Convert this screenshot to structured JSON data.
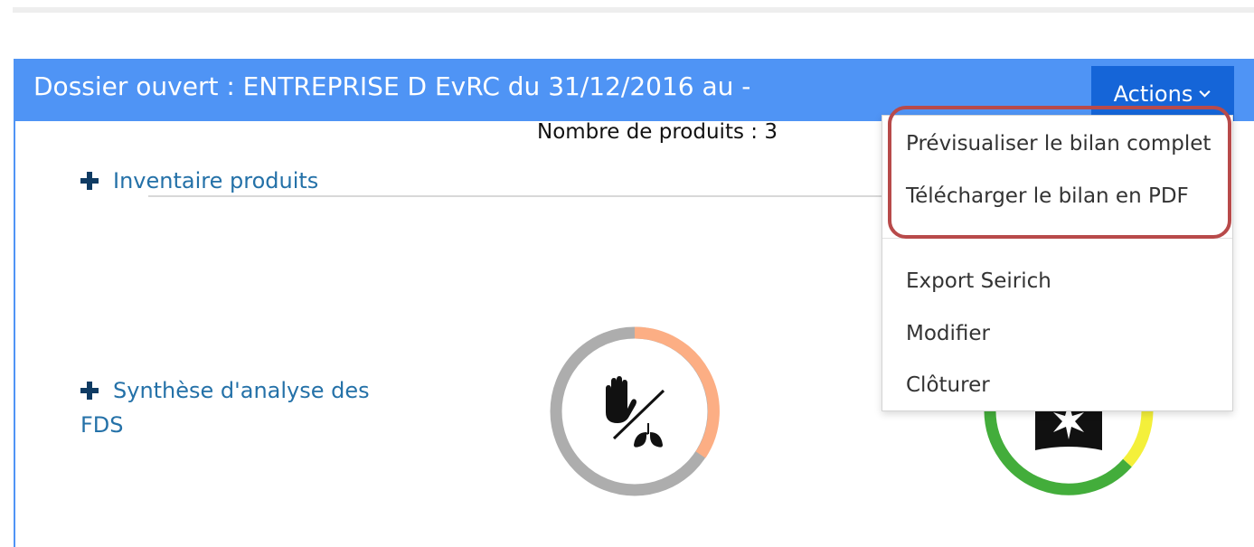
{
  "header": {
    "title": "Dossier ouvert : ENTREPRISE D EvRC du 31/12/2016 au -",
    "actions_label": "Actions"
  },
  "sections": {
    "inventory_label": "Inventaire produits",
    "product_count_text": "Nombre de produits : 3",
    "synthesis_label_line1": "Synthèse d'analyse des",
    "synthesis_label_line2": "FDS"
  },
  "donuts": [
    {
      "icon": "hand-lungs-icon",
      "segments": [
        {
          "color": "#fcae84",
          "fraction": 0.36
        },
        {
          "color": "#adadad",
          "fraction": 0.64
        }
      ]
    },
    {
      "icon": "health-hazard-icon",
      "segments": [
        {
          "color": "#f4f03a",
          "fraction": 0.15
        },
        {
          "color": "#43ad3b",
          "fraction": 0.35
        }
      ]
    }
  ],
  "actions_menu": {
    "items": [
      "Prévisualiser le bilan complet",
      "Télécharger le bilan en PDF",
      "Export Seirich",
      "Modifier",
      "Clôturer"
    ]
  },
  "colors": {
    "header_bg": "#4f94f5",
    "actions_bg": "#1565d8",
    "link": "#2471a8",
    "highlight": "#b84a4a"
  }
}
